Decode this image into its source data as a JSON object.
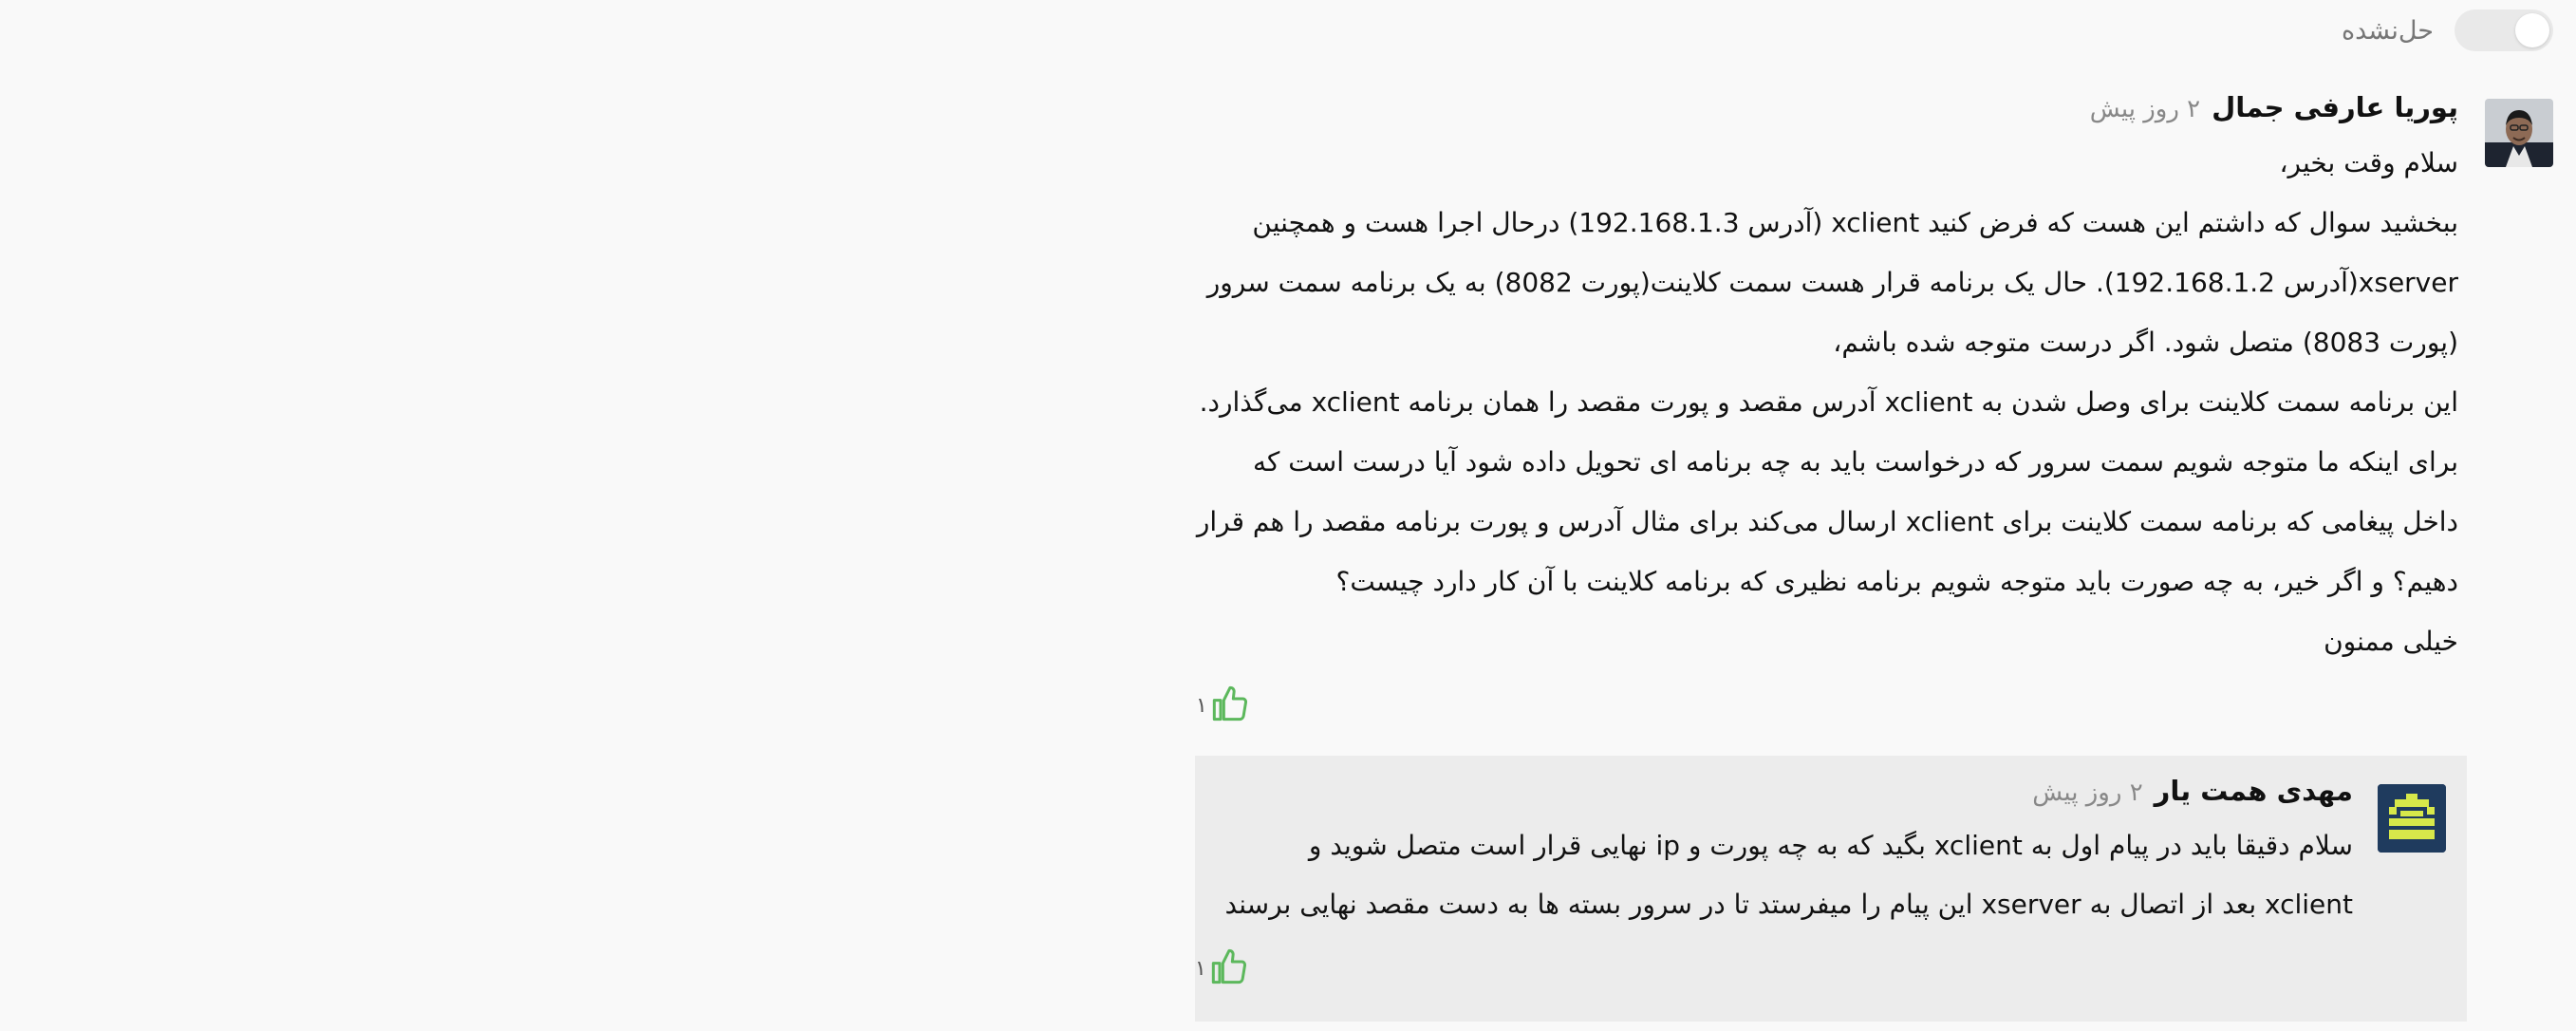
{
  "toggle": {
    "label": "حل‌نشده",
    "state": "off"
  },
  "question": {
    "author": "پوریا عارفی جمال",
    "time": "۲ روز پیش",
    "lines": [
      "سلام وقت بخیر،",
      "ببخشید سوال که داشتم این هست که فرض کنید xclient (آدرس 192.168.1.3) درحال اجرا هست و همچنین",
      "xserver(آدرس 192.168.1.2). حال یک برنامه قرار هست سمت کلاینت(پورت 8082) به یک برنامه سمت سرور",
      "(پورت 8083) متصل شود. اگر درست متوجه شده باشم،",
      "این برنامه سمت کلاینت برای وصل شدن به xclient آدرس مقصد و پورت مقصد را همان برنامه xclient می‌گذارد.",
      "برای اینکه ما متوجه شویم سمت سرور که درخواست باید به چه برنامه ای تحویل داده شود آیا درست است که",
      "داخل پیغامی که برنامه سمت کلاینت برای xclient ارسال می‌کند برای مثال آدرس و پورت برنامه مقصد را هم قرار",
      "دهیم؟  و اگر خیر، به چه صورت باید متوجه شویم برنامه نظیری که برنامه کلاینت با آن کار دارد چیست؟",
      "خیلی ممنون"
    ],
    "likes": "۱"
  },
  "reply": {
    "author": "مهدی همت یار",
    "time": "۲ روز پیش",
    "lines": [
      "سلام دقیقا باید در پیام اول به xclient بگید که به چه پورت و ip  نهایی قرار است متصل شوید و",
      "xclient بعد از اتصال به xserver این پیام را میفرستد تا در سرور بسته ها به دست مقصد نهایی برسند"
    ],
    "likes": "۱"
  },
  "colors": {
    "like_icon": "#5cb85c",
    "page_bg": "#f9f9f9",
    "reply_bg": "#ececec",
    "muted": "#888888"
  },
  "icons": {
    "like": "thumbs-up-icon",
    "question_avatar": "user-photo-avatar",
    "reply_avatar": "pixel-avatar"
  }
}
